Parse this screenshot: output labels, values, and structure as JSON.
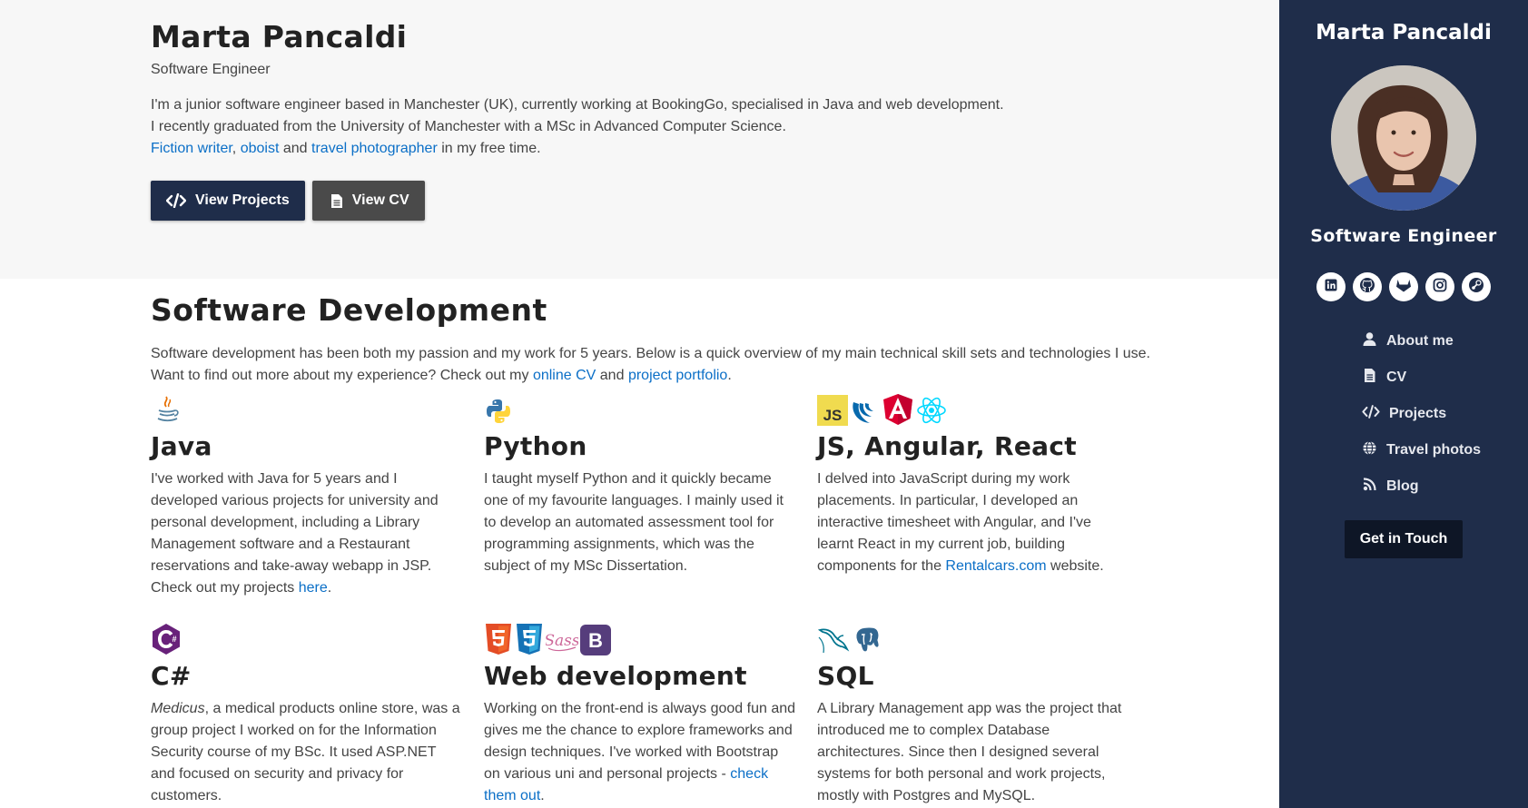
{
  "hero": {
    "name": "Marta Pancaldi",
    "subtitle": "Software Engineer",
    "intro_line1": "I'm a junior software engineer based in Manchester (UK), currently working at BookingGo, specialised in Java and web development.",
    "intro_line2": "I recently graduated from the University of Manchester with a MSc in Advanced Computer Science.",
    "link_fiction": "Fiction writer",
    "sep_comma": ",",
    "link_oboist": "oboist",
    "and1": "and",
    "link_travel": "travel photographer",
    "free_time": "in my free time.",
    "btn_projects": "View Projects",
    "btn_cv": "View CV"
  },
  "dev": {
    "heading": "Software Development",
    "lead_line1": "Software development has been both my passion and my work for 5 years. Below is a quick overview of my main technical skill sets and technologies I use.",
    "lead_line2_pre": "Want to find out more about my experience? Check out my",
    "link_cv": "online CV",
    "and": "and",
    "link_portfolio": "project portfolio",
    "period": ".",
    "cards": [
      {
        "title": "Java",
        "icons": [
          "java-icon"
        ],
        "text": "I've worked with Java for 5 years and I developed various projects for university and personal development, including a Library Management software and a Restaurant reservations and take-away webapp in JSP. Check out my projects",
        "link": "here",
        "tail": "."
      },
      {
        "title": "Python",
        "icons": [
          "python-icon"
        ],
        "text": "I taught myself Python and it quickly became one of my favourite languages. I mainly used it to develop an automated assessment tool for programming assignments, which was the subject of my MSc Dissertation."
      },
      {
        "title": "JS, Angular, React",
        "icons": [
          "javascript-icon",
          "jquery-icon",
          "angular-icon",
          "react-icon"
        ],
        "text": "I delved into JavaScript during my work placements. In particular, I developed an interactive timesheet with Angular, and I've learnt React in my current job, building components for the",
        "link": "Rentalcars.com",
        "tail": " website."
      },
      {
        "title": "C#",
        "icons": [
          "csharp-icon"
        ],
        "em": "Medicus",
        "text": ", a medical products online store, was a group project I worked on for the Information Security course of my BSc. It used ASP.NET and focused on security and privacy for customers."
      },
      {
        "title": "Web development",
        "icons": [
          "html5-icon",
          "css3-icon",
          "sass-icon",
          "bootstrap-icon"
        ],
        "text": "Working on the front-end is always good fun and gives me the chance to explore frameworks and design techniques. I've worked with Bootstrap on various uni and personal projects -",
        "link": "check them out",
        "tail": "."
      },
      {
        "title": "SQL",
        "icons": [
          "mysql-icon",
          "postgresql-icon"
        ],
        "text": "A Library Management app was the project that introduced me to complex Database architectures. Since then I designed several systems for both personal and work projects, mostly with Postgres and MySQL."
      }
    ]
  },
  "sidebar": {
    "name": "Marta Pancaldi",
    "role": "Software Engineer",
    "socials": [
      "linkedin-icon",
      "github-icon",
      "gitlab-icon",
      "instagram-icon",
      "steam-icon"
    ],
    "nav": [
      {
        "label": "About me",
        "icon": "user-icon"
      },
      {
        "label": "CV",
        "icon": "document-icon"
      },
      {
        "label": "Projects",
        "icon": "code-icon"
      },
      {
        "label": "Travel photos",
        "icon": "globe-icon"
      },
      {
        "label": "Blog",
        "icon": "rss-icon"
      }
    ],
    "cta": "Get in Touch"
  },
  "colors": {
    "sidebar_bg": "#1f2d4a",
    "link": "#0b6fc7",
    "hero_bg": "#f7f7f7"
  }
}
